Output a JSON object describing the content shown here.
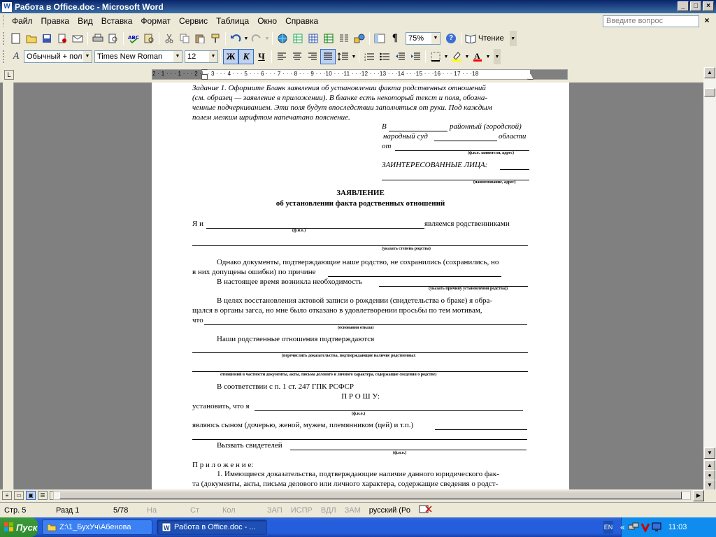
{
  "window": {
    "title": "Работа в Office.doc - Microsoft Word",
    "app_icon": "word-doc-icon",
    "controls": {
      "minimize": "_",
      "maximize": "□",
      "close": "×"
    }
  },
  "menubar": {
    "items": [
      "Файл",
      "Правка",
      "Вид",
      "Вставка",
      "Формат",
      "Сервис",
      "Таблица",
      "Окно",
      "Справка"
    ],
    "help_placeholder": "Введите вопрос",
    "close_glyph": "×"
  },
  "toolbar_standard": {
    "zoom": "75%",
    "reading_label": "Чтение",
    "pilcrow": "¶",
    "help_glyph": "?"
  },
  "toolbar_formatting": {
    "style": "Обычный + пол",
    "font": "Times New Roman",
    "size": "12",
    "bold": "Ж",
    "italic": "К",
    "underline": "Ч",
    "styles_glyph": "A"
  },
  "ruler": {
    "corner": "L",
    "marks": "2 · 1 · · · 1 · · · 2 · · · 3 · · · 4 · · · 5 · · · 6 · · · 7 · · · 8 · · · 9 · · ·10 · · ·11 · · ·12 · · ·13 · · ·14 · · ·15 · · ·16 · · · 17 · · ·18"
  },
  "document": {
    "task": [
      "Задание 1. Оформите Бланк заявления об установлении факта родственных отношений",
      "(см. образец —  заявление в приложении). В бланке есть некоторый текст и поля, обознa-",
      "ченные подчеркиванием. Эти поля будут впоследствии заполняться от руки. Под каждым",
      "полем мелким шрифтом напечатано пояснение."
    ],
    "court": {
      "line1_prefix": "В",
      "line1_suffix": "районный (городской)",
      "line2_prefix": "народный суд",
      "line2_suffix": "области",
      "line3_prefix": "от",
      "hint_applicant": "(ф.и.о. заявителя, адрес)",
      "interested": "ЗАИНТЕРЕСОВАННЫЕ ЛИЦА:",
      "hint_interested": "(наименование, адрес)"
    },
    "heading": "ЗАЯВЛЕНИЕ",
    "subheading": "об установлении факта родственных отношений",
    "body": {
      "i_prefix": "Я и",
      "i_suffix": "являемся родственниками",
      "hint_fio": "(ф.и.о.)",
      "hint_degree": "(указать степень родства)",
      "p1_line1": "Однако документы, подтверждающие  наше родство, не сохранились (сохранились, но",
      "p1_line2": "в них допущены ошибки) по причине",
      "p2": "В настоящее время возникла необходимость",
      "hint_purpose": "(указать причину установления родства))",
      "p3_line1": "В целях восстановления актовой записи о рождении (свидетельства о браке) я обра-",
      "p3_line2": "щался в органы загса, но мне было отказано в удовлетворении просьбы по тем мотивам,",
      "p3_line3": "что",
      "hint_refusal": "(основания отказа)",
      "p4": "Наши родственные отношения подтверждаются",
      "hint_proof": "(перечислить доказательства, подтверждающие наличие родственных",
      "hint_proof2": "отношений в частности документы, акты, письма делового и личного характера, содержащие сведения о родстве)",
      "p5": "В соответствии с п. 1 ст. 247 ГПК РСФСР",
      "prosu": "П Р О Ш У:",
      "p6": "установить, что я",
      "p7": "являюсь сыном (дочерью, женой, мужем, племянником (цей) и т.п.)",
      "p8": "Вызвать свидетелей",
      "appendix": "П р и л о ж е н и е:",
      "a1_line1": "1. Имеющиеся доказательства, подтверждающие наличие данного юридического фак-",
      "a1_line2": "та (документы, акты, письма делового или личного характера, содержащие сведения о родст-"
    }
  },
  "statusbar": {
    "page": "Стр. 5",
    "section": "Разд 1",
    "pages": "5/78",
    "at": "На",
    "line": "Ст",
    "col": "Кол",
    "rec": "ЗАП",
    "trk": "ИСПР",
    "ext": "ВДЛ",
    "ovr": "ЗАМ",
    "lang": "русский (Ро"
  },
  "taskbar": {
    "start": "Пуск",
    "tasks": [
      "Z:\\1_БухУч\\Абенова",
      "Работа в Office.doc - ..."
    ],
    "lang": "EN",
    "clock": "11:03",
    "chevron": "«"
  }
}
